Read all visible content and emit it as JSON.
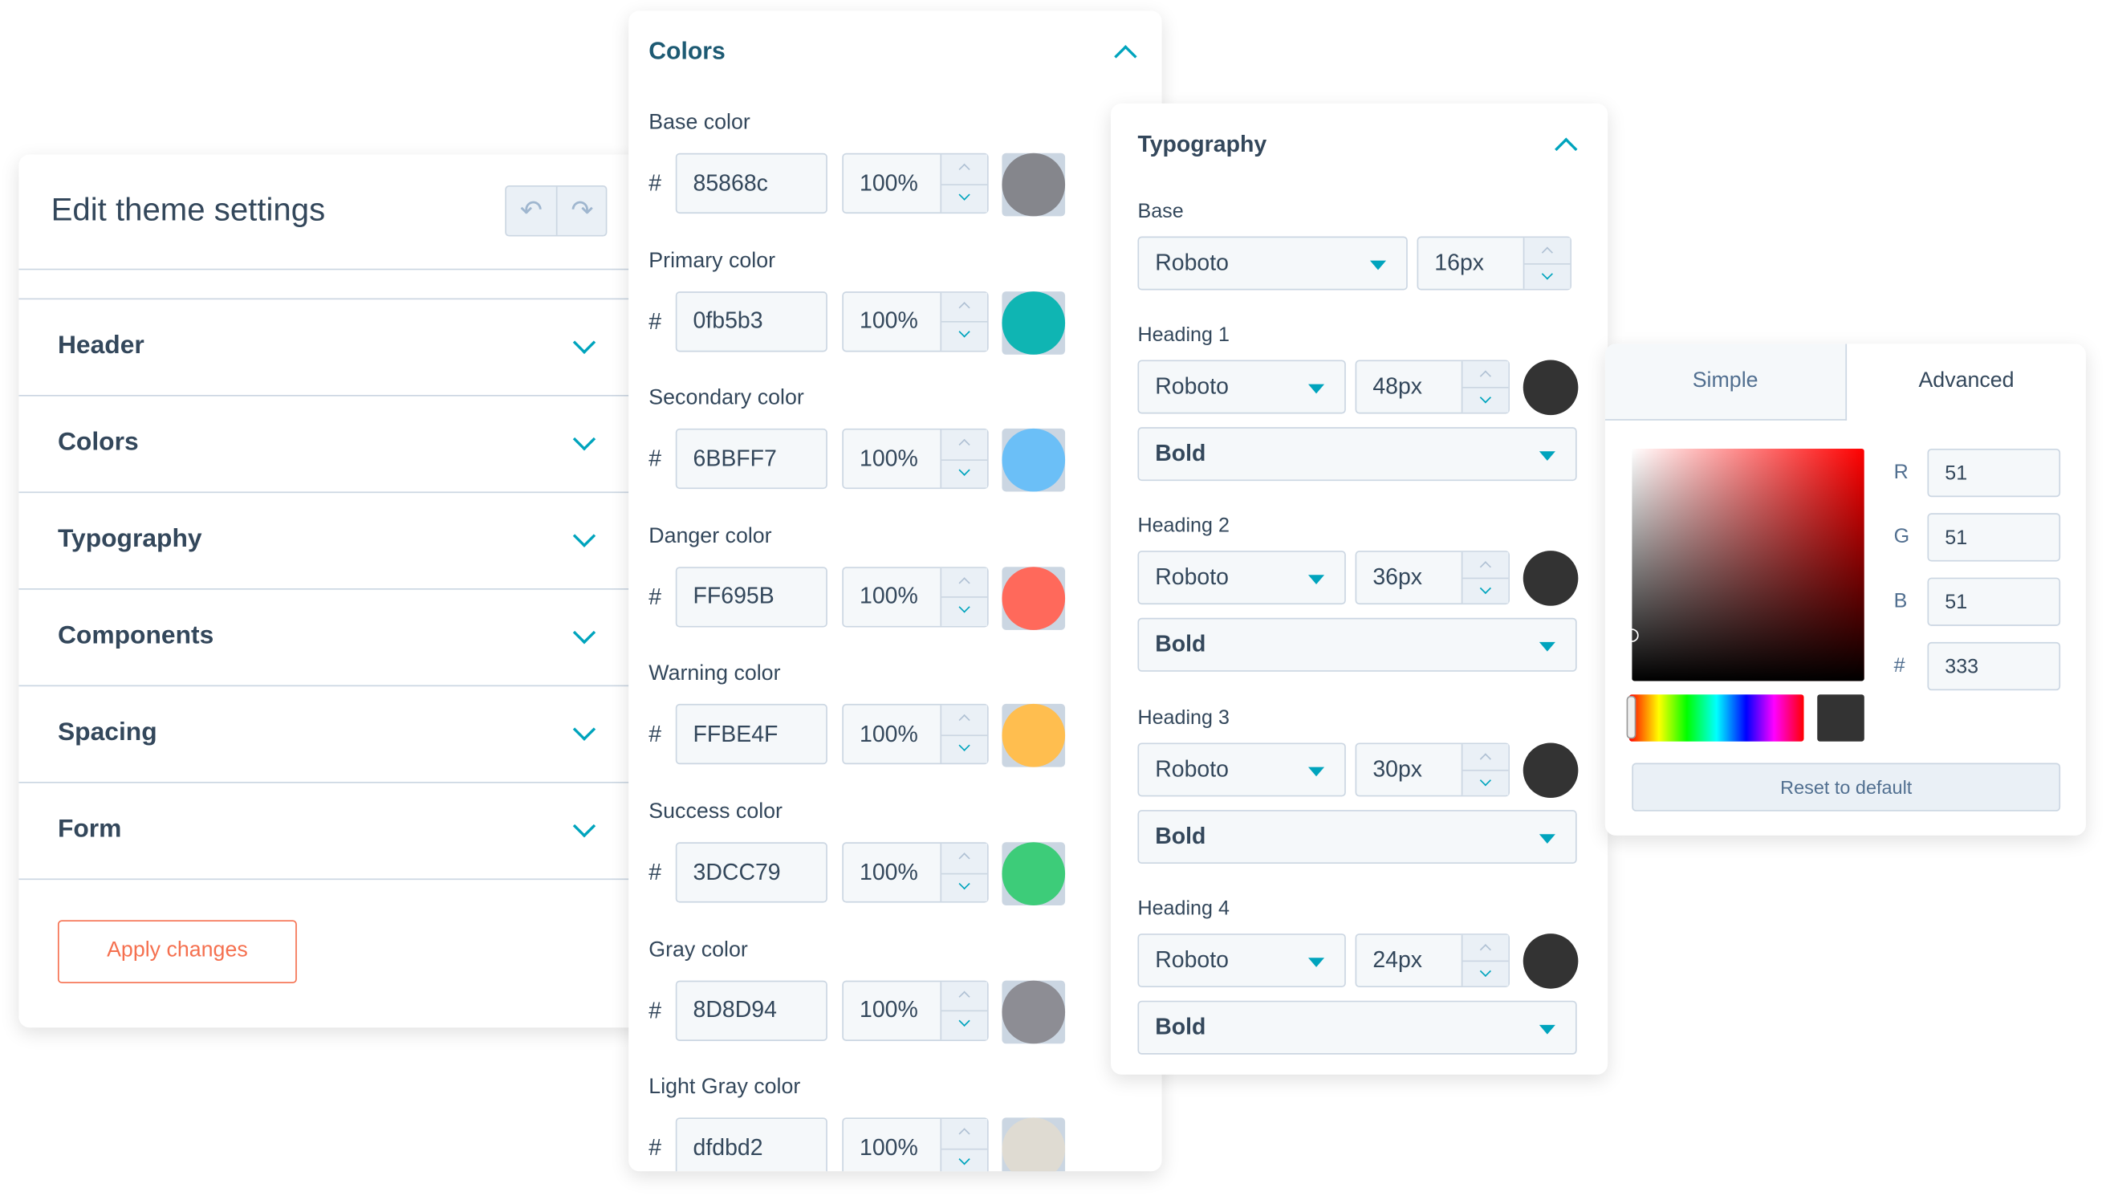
{
  "settings": {
    "title": "Edit theme settings",
    "undo_icon": "undo-icon",
    "redo_icon": "redo-icon",
    "sections": [
      {
        "label": "Header"
      },
      {
        "label": "Colors"
      },
      {
        "label": "Typography"
      },
      {
        "label": "Components"
      },
      {
        "label": "Spacing"
      },
      {
        "label": "Form"
      }
    ],
    "apply_label": "Apply changes",
    "apply_color": "#f5704f"
  },
  "colors_panel": {
    "title": "Colors",
    "hash": "#",
    "items": [
      {
        "label": "Base color",
        "hex": "85868c",
        "opacity": "100%",
        "swatch": "#85868c"
      },
      {
        "label": "Primary color",
        "hex": "0fb5b3",
        "opacity": "100%",
        "swatch": "#0fb5b3"
      },
      {
        "label": "Secondary color",
        "hex": "6BBFF7",
        "opacity": "100%",
        "swatch": "#6bbff7"
      },
      {
        "label": "Danger color",
        "hex": "FF695B",
        "opacity": "100%",
        "swatch": "#ff695b"
      },
      {
        "label": "Warning color",
        "hex": "FFBE4F",
        "opacity": "100%",
        "swatch": "#ffbe4f"
      },
      {
        "label": "Success color",
        "hex": "3DCC79",
        "opacity": "100%",
        "swatch": "#3dcc79"
      },
      {
        "label": "Gray color",
        "hex": "8D8D94",
        "opacity": "100%",
        "swatch": "#8d8d94"
      },
      {
        "label": "Light Gray color",
        "hex": "dfdbd2",
        "opacity": "100%",
        "swatch": "#dfdbd2"
      }
    ]
  },
  "typography_panel": {
    "title": "Typography",
    "base": {
      "label": "Base",
      "font": "Roboto",
      "size": "16px"
    },
    "headings": [
      {
        "label": "Heading 1",
        "font": "Roboto",
        "size": "48px",
        "weight": "Bold",
        "color": "#333333"
      },
      {
        "label": "Heading 2",
        "font": "Roboto",
        "size": "36px",
        "weight": "Bold",
        "color": "#333333"
      },
      {
        "label": "Heading 3",
        "font": "Roboto",
        "size": "30px",
        "weight": "Bold",
        "color": "#333333"
      },
      {
        "label": "Heading 4",
        "font": "Roboto",
        "size": "24px",
        "weight": "Bold",
        "color": "#333333"
      }
    ]
  },
  "picker": {
    "tabs": [
      {
        "label": "Simple"
      },
      {
        "label": "Advanced"
      }
    ],
    "hue_color": "#ff0000",
    "r_label": "R",
    "r": "51",
    "g_label": "G",
    "g": "51",
    "b_label": "B",
    "b": "51",
    "hex_label": "#",
    "hex": "333",
    "preview": "#333333",
    "reset_label": "Reset to default"
  }
}
